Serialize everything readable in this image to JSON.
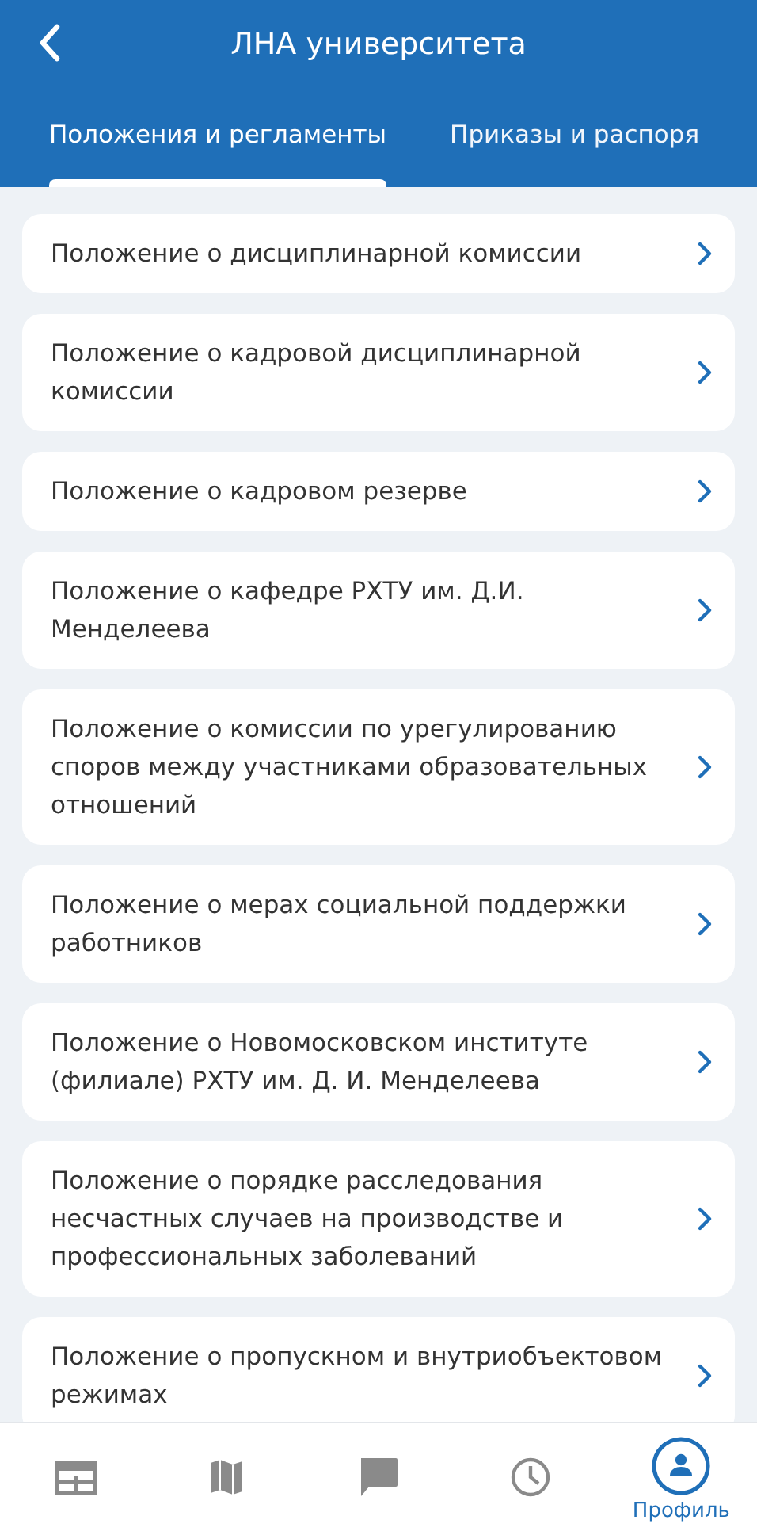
{
  "header": {
    "title": "ЛНА университета"
  },
  "tabs": [
    {
      "label": "Положения и регламенты",
      "selected": true
    },
    {
      "label": "Приказы и распоря",
      "selected": false
    }
  ],
  "documents": [
    {
      "title": "Положение о дисциплинарной комиссии"
    },
    {
      "title": "Положение о кадровой дисциплинарной комиссии"
    },
    {
      "title": "Положение о кадровом резерве"
    },
    {
      "title": "Положение о кафедре РХТУ им. Д.И. Менделеева"
    },
    {
      "title": "Положение о комиссии по урегулированию споров между участниками образовательных отношений"
    },
    {
      "title": "Положение о мерах социальной поддержки работников"
    },
    {
      "title": "Положение о Новомосковском институте (филиале) РХТУ им. Д. И. Менделеева"
    },
    {
      "title": "Положение о порядке расследования несчастных случаев на производстве и профессиональных заболеваний"
    },
    {
      "title": "Положение о пропускном и внутриобъектовом режимах"
    }
  ],
  "bottom_nav": [
    {
      "kind": "schedule",
      "selected": false
    },
    {
      "kind": "map",
      "selected": false
    },
    {
      "kind": "chat",
      "selected": false
    },
    {
      "kind": "history",
      "selected": false
    },
    {
      "kind": "profile",
      "label": "Профиль",
      "selected": true
    }
  ]
}
